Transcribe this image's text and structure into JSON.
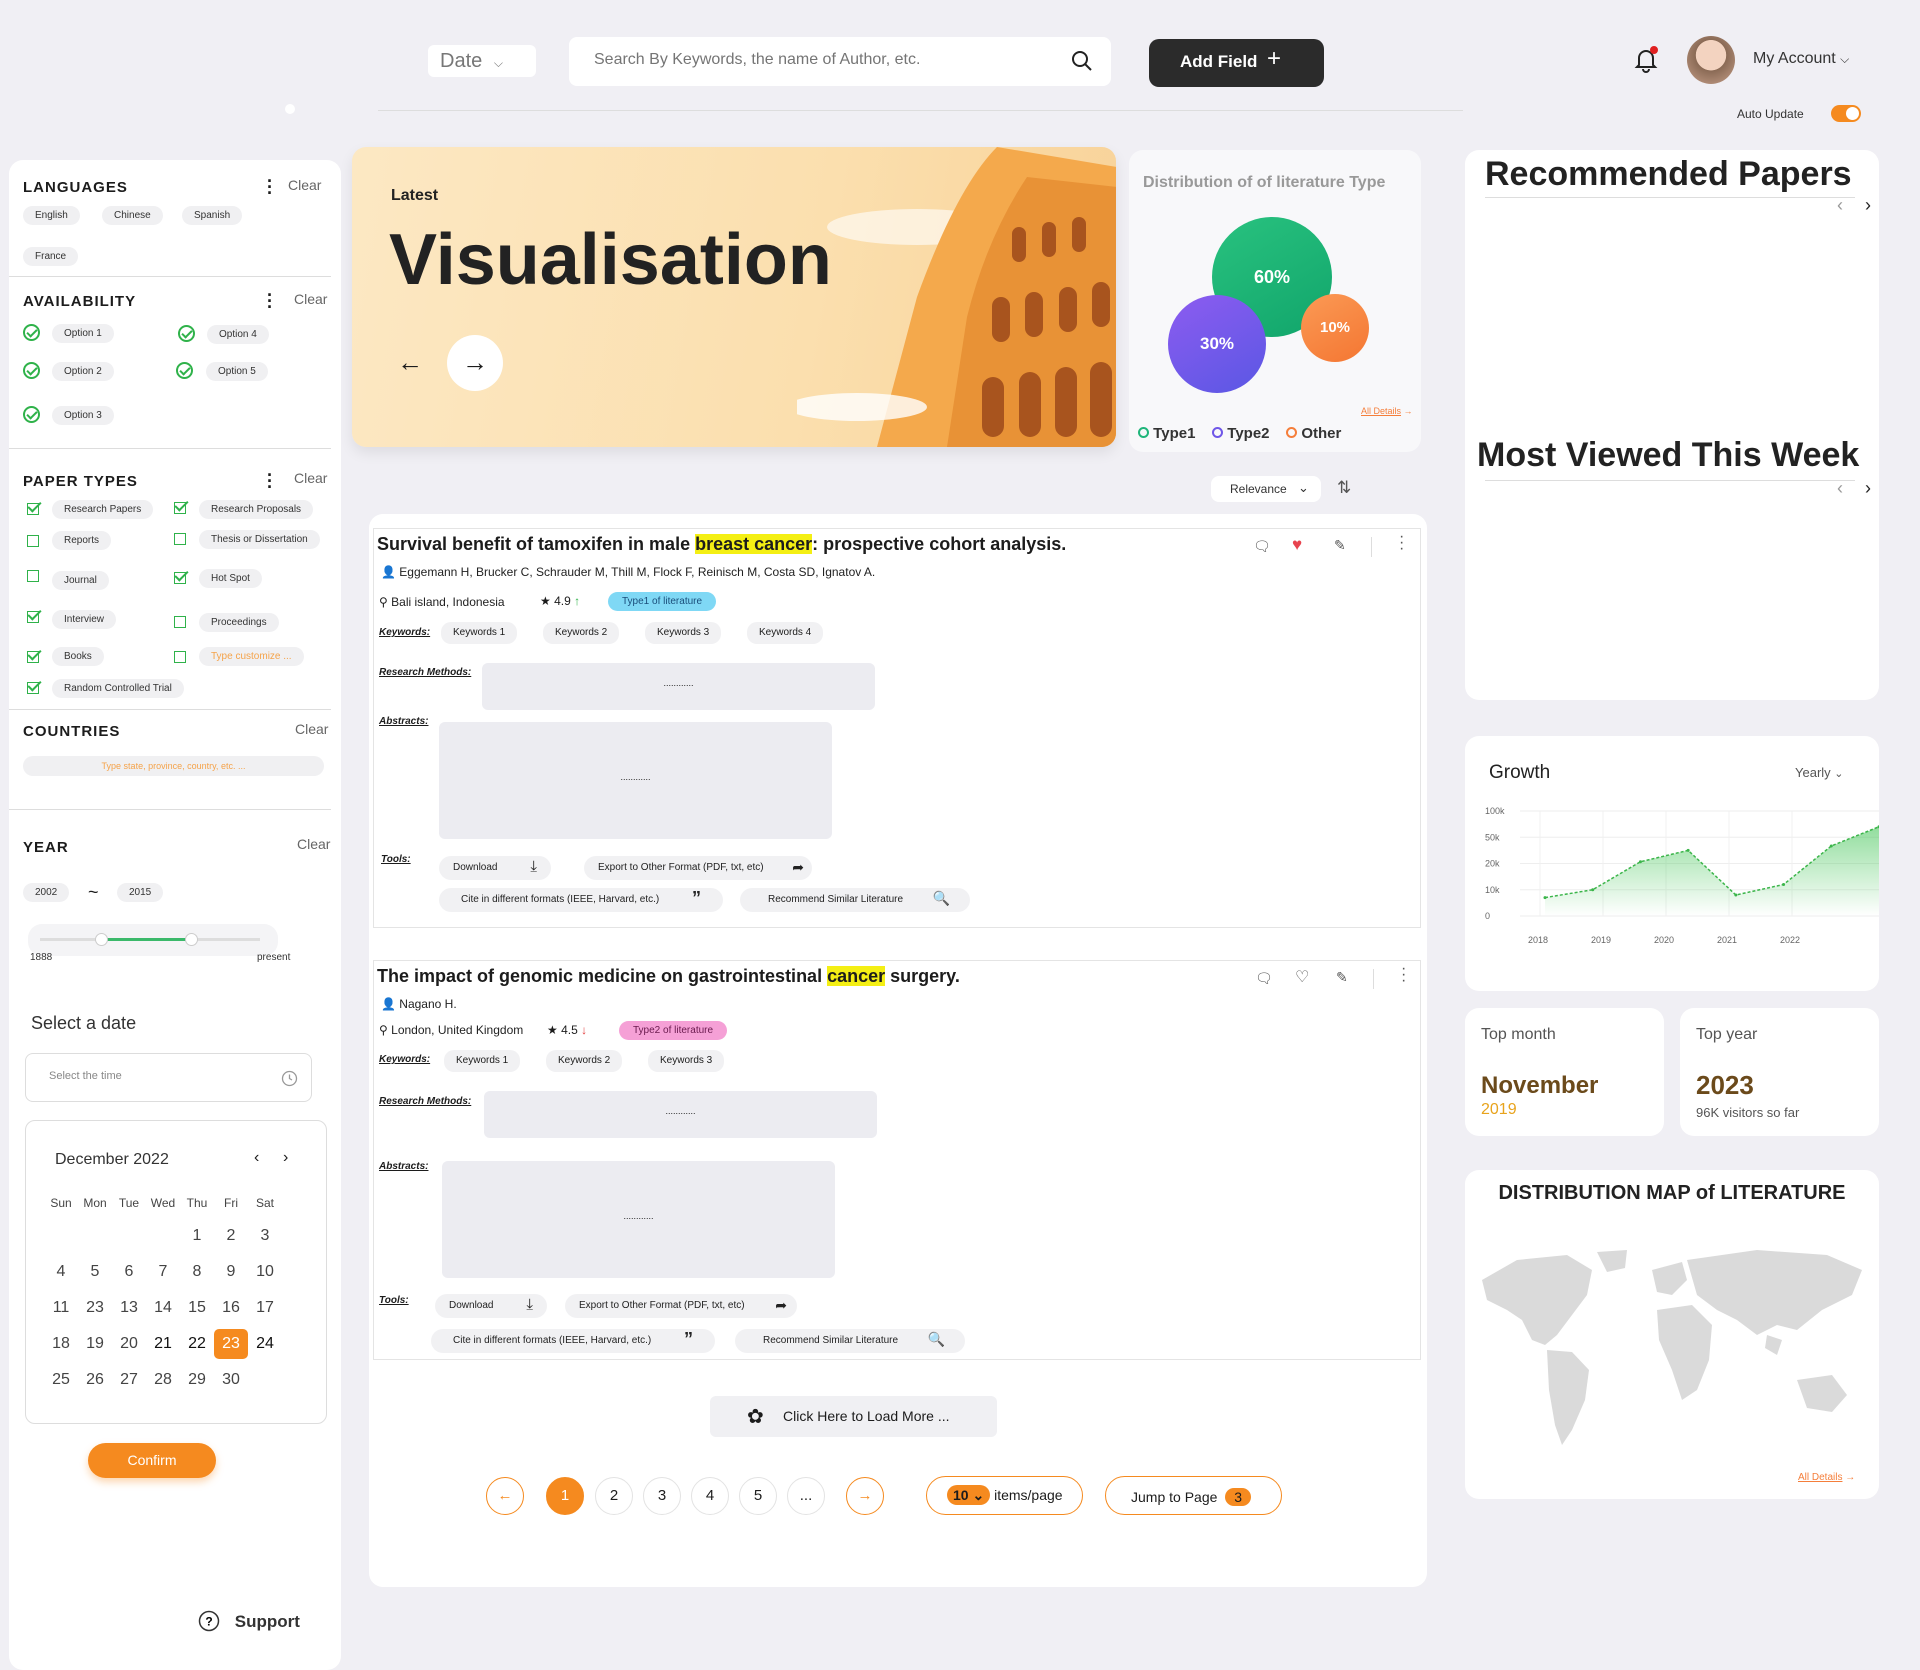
{
  "header": {
    "date_label": "Date",
    "search_placeholder": "Search By Keywords, the name of Author, etc.",
    "add_field": "Add Field",
    "account": "My Account",
    "auto_update": "Auto Update"
  },
  "filters": {
    "languages": {
      "title": "LANGUAGES",
      "clear": "Clear",
      "items": [
        "English",
        "Chinese",
        "Spanish",
        "France"
      ]
    },
    "availability": {
      "title": "AVAILABILITY",
      "clear": "Clear",
      "items": [
        "Option 1",
        "Option 4",
        "Option 2",
        "Option 5",
        "Option 3"
      ]
    },
    "paper_types": {
      "title": "PAPER TYPES",
      "clear": "Clear",
      "items": [
        "Research Papers",
        "Research Proposals",
        "Reports",
        "Thesis or Dissertation",
        "Journal",
        "Hot Spot",
        "Interview",
        "Proceedings",
        "Books",
        "Type customize ...",
        "Random Controlled Trial"
      ]
    },
    "countries": {
      "title": "COUNTRIES",
      "clear": "Clear",
      "placeholder": "Type state, province, country, etc. ..."
    },
    "year": {
      "title": "YEAR",
      "clear": "Clear",
      "from": "2002",
      "to": "2015",
      "tilde": "~",
      "min": "1888",
      "max": "present",
      "range_fraction": [
        0.5,
        0.98
      ]
    },
    "date": {
      "title": "Select a date",
      "placeholder": "Select the time",
      "month": "December 2022",
      "days": [
        "Sun",
        "Mon",
        "Tue",
        "Wed",
        "Thu",
        "Fri",
        "Sat"
      ],
      "selected": "23",
      "confirm": "Confirm"
    },
    "support": "Support"
  },
  "hero": {
    "kicker": "Latest",
    "title": "Visualisation"
  },
  "distribution": {
    "title": "Distribution of  of literature Type",
    "all_details": "All Details",
    "legend": [
      "Type1",
      "Type2",
      "Other"
    ],
    "values": [
      "60%",
      "30%",
      "10%"
    ],
    "colors": [
      "#1fb57a",
      "#6f56e8",
      "#f57e3a"
    ]
  },
  "sort": {
    "label": "Relevance"
  },
  "papers": [
    {
      "title_pre": "Survival benefit of tamoxifen in male ",
      "title_hl": "breast cancer",
      "title_post": ": prospective cohort analysis.",
      "authors": "Eggemann H, Brucker C, Schrauder M, Thill M, Flock F, Reinisch M, Costa SD, Ignatov A.",
      "location": "Bali island, Indonesia",
      "rating": "4.9",
      "type": "Type1 of literature",
      "keywords_label": "Keywords:",
      "keywords": [
        "Keywords 1",
        "Keywords 2",
        "Keywords 3",
        "Keywords 4"
      ],
      "methods_label": "Research Methods:",
      "abstracts_label": "Abstracts:",
      "tools_label": "Tools:",
      "placeholder": "............",
      "tools": [
        "Download",
        "Export to Other Format (PDF, txt, etc)",
        "Cite in different formats (IEEE, Harvard, etc.)",
        "Recommend Similar Literature"
      ]
    },
    {
      "title_pre": "The impact of genomic medicine on gastrointestinal ",
      "title_hl": "cancer",
      "title_post": " surgery.",
      "authors": "Nagano H.",
      "location": "London, United Kingdom",
      "rating": "4.5",
      "type": "Type2 of literature",
      "keywords_label": "Keywords:",
      "keywords": [
        "Keywords 1",
        "Keywords 2",
        "Keywords 3"
      ],
      "methods_label": "Research Methods:",
      "abstracts_label": "Abstracts:",
      "tools_label": "Tools:",
      "placeholder": "............",
      "tools": [
        "Download",
        "Export to Other Format (PDF, txt, etc)",
        "Cite in different formats (IEEE, Harvard, etc.)",
        "Recommend Similar Literature"
      ]
    }
  ],
  "load_more": "Click Here to Load More ...",
  "pagination": {
    "pages": [
      "1",
      "2",
      "3",
      "4",
      "5",
      "..."
    ],
    "items_count": "10",
    "items_label": "items/page",
    "jump_label": "Jump to Page",
    "jump_value": "3"
  },
  "right": {
    "recommended": "Recommended Papers",
    "most_viewed": "Most Viewed This Week",
    "top_month_label": "Top month",
    "top_month": "November",
    "top_month_year": "2019",
    "top_year_label": "Top year",
    "top_year": "2023",
    "top_year_sub": "96K visitors so far",
    "map_title": "DISTRIBUTION MAP of LITERATURE",
    "all_details": "All Details"
  },
  "chart_data": {
    "type": "area",
    "title": "Growth",
    "period": "Yearly",
    "x": [
      "2018",
      "2019",
      "2020",
      "2021",
      "2022"
    ],
    "y_ticks": [
      "100k",
      "50k",
      "20k",
      "10k",
      "0"
    ],
    "values": [
      7000,
      10000,
      22000,
      35000,
      8000,
      12000,
      40000,
      70000
    ]
  }
}
